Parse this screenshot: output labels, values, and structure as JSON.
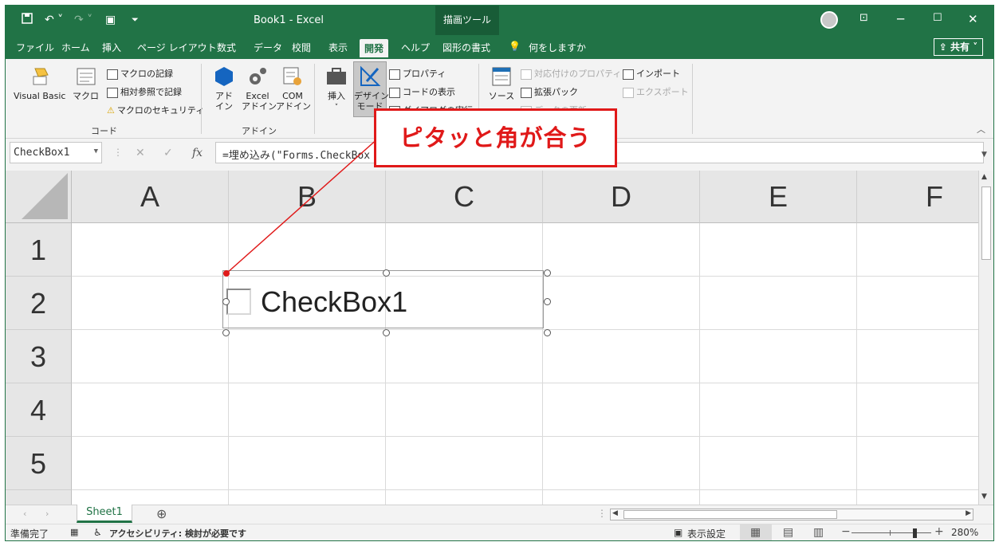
{
  "titlebar": {
    "title": "Book1  -  Excel",
    "context_tab": "描画ツール"
  },
  "tabs": [
    "ファイル",
    "ホーム",
    "挿入",
    "ページ レイアウト",
    "数式",
    "データ",
    "校閲",
    "表示",
    "開発",
    "ヘルプ",
    "図形の書式"
  ],
  "active_tab": "開発",
  "tell_me": "何をしますか",
  "share_label": "共有",
  "ribbon": {
    "visual_basic": "Visual Basic",
    "macro": "マクロ",
    "record_macro": "マクロの記録",
    "relative_ref": "相対参照で記録",
    "macro_security": "マクロのセキュリティ",
    "group_code": "コード",
    "addin": "アド\nイン",
    "excel_addin": "Excel\nアドイン",
    "com_addin": "COM\nアドイン",
    "group_addin": "アドイン",
    "insert": "挿入",
    "design_mode": "デザイン\nモード",
    "properties": "プロパティ",
    "view_code": "コードの表示",
    "run_dialog": "ダイアログの実行",
    "source": "ソース",
    "map_props": "対応付けのプロパティ",
    "expansion_pack": "拡張パック",
    "refresh_data": "データの更新",
    "import": "インポート",
    "export": "エクスポート"
  },
  "formula_bar": {
    "name_box": "CheckBox1",
    "formula": "=埋め込み(\"Forms.CheckBox"
  },
  "columns": [
    "A",
    "B",
    "C",
    "D",
    "E",
    "F"
  ],
  "rows": [
    "1",
    "2",
    "3",
    "4",
    "5"
  ],
  "checkbox": {
    "label": "CheckBox1"
  },
  "callout": {
    "text": "ピタッと角が合う",
    "color": "#e01919"
  },
  "sheet_tab": "Sheet1",
  "status": {
    "ready": "準備完了",
    "accessibility": "アクセシビリティ: 検討が必要です",
    "display_settings": "表示設定",
    "zoom": "280%"
  },
  "colors": {
    "excel_green": "#217346"
  }
}
